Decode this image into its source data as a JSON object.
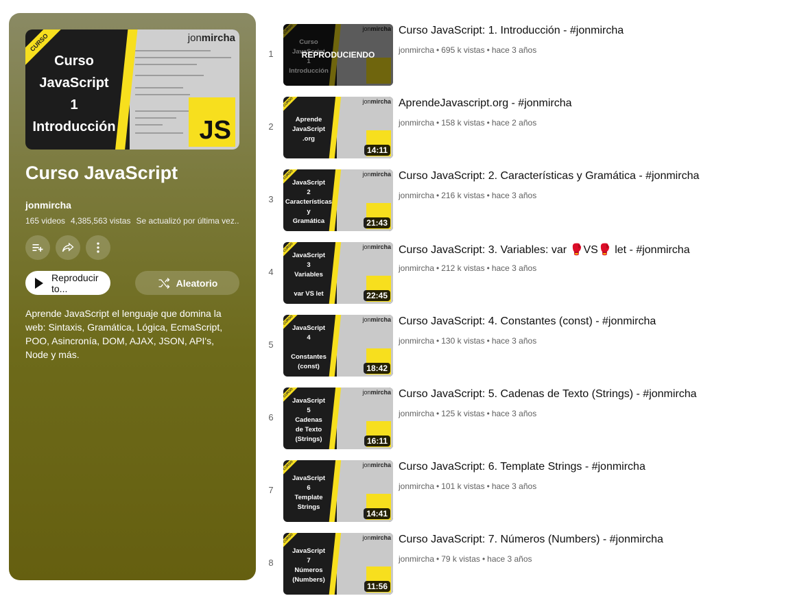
{
  "playlist": {
    "thumbnail": {
      "corner_label": "CURSO",
      "title_lines": [
        "Curso",
        "JavaScript",
        "1",
        "Introducción"
      ],
      "brand_light": "jon",
      "brand_bold": "mircha",
      "js_label": "JS"
    },
    "title": "Curso JavaScript",
    "owner": "jonmircha",
    "videos_count": "165 videos",
    "views": "4,385,563 vistas",
    "updated": "Se actualizó por última vez...",
    "icons": [
      "playlist-add-icon",
      "share-icon",
      "more-vert-icon"
    ],
    "play_all_label": "Reproducir to...",
    "shuffle_label": "Aleatorio",
    "description": "Aprende JavaScript el lenguaje que domina la web: Sintaxis, Gramática, Lógica, EcmaScript, POO, Asincronía, DOM, AJAX, JSON, API's, Node y más."
  },
  "videos": [
    {
      "index": "1",
      "title": "Curso JavaScript: 1. Introducción - #jonmircha",
      "channel": "jonmircha",
      "views": "695 k vistas",
      "age": "hace 3 años",
      "thumb_text": "Curso\nJavaScript\n1\nIntroducción",
      "status": "REPRODUCIENDO",
      "duration": ""
    },
    {
      "index": "2",
      "title": "AprendeJavascript.org - #jonmircha",
      "channel": "jonmircha",
      "views": "158 k vistas",
      "age": "hace 2 años",
      "thumb_text": "Aprende\nJavaScript\n.org",
      "status": "",
      "duration": "14:11"
    },
    {
      "index": "3",
      "title": "Curso JavaScript: 2. Características y Gramática - #jonmircha",
      "channel": "jonmircha",
      "views": "216 k vistas",
      "age": "hace 3 años",
      "thumb_text": "JavaScript\n2\nCaracterísticas\ny\nGramática",
      "status": "",
      "duration": "21:43"
    },
    {
      "index": "4",
      "title": "Curso JavaScript: 3. Variables: var 🥊VS🥊 let - #jonmircha",
      "channel": "jonmircha",
      "views": "212 k vistas",
      "age": "hace 3 años",
      "thumb_text": "JavaScript\n3\nVariables\n\nvar VS let",
      "status": "",
      "duration": "22:45"
    },
    {
      "index": "5",
      "title": "Curso JavaScript: 4. Constantes (const) - #jonmircha",
      "channel": "jonmircha",
      "views": "130 k vistas",
      "age": "hace 3 años",
      "thumb_text": "JavaScript\n4\n\nConstantes\n(const)",
      "status": "",
      "duration": "18:42"
    },
    {
      "index": "6",
      "title": "Curso JavaScript: 5. Cadenas de Texto (Strings) - #jonmircha",
      "channel": "jonmircha",
      "views": "125 k vistas",
      "age": "hace 3 años",
      "thumb_text": "JavaScript\n5\nCadenas\nde Texto\n(Strings)",
      "status": "",
      "duration": "16:11"
    },
    {
      "index": "7",
      "title": "Curso JavaScript: 6. Template Strings - #jonmircha",
      "channel": "jonmircha",
      "views": "101 k vistas",
      "age": "hace 3 años",
      "thumb_text": "JavaScript\n6\nTemplate\nStrings",
      "status": "",
      "duration": "14:41"
    },
    {
      "index": "8",
      "title": "Curso JavaScript: 7. Números (Numbers) - #jonmircha",
      "channel": "jonmircha",
      "views": "79 k vistas",
      "age": "hace 3 años",
      "thumb_text": "JavaScript\n7\nNúmeros\n(Numbers)",
      "status": "",
      "duration": "11:56"
    }
  ],
  "colors": {
    "accent_yellow": "#f7df1e",
    "sidebar_bg": "#6d6a1a"
  }
}
